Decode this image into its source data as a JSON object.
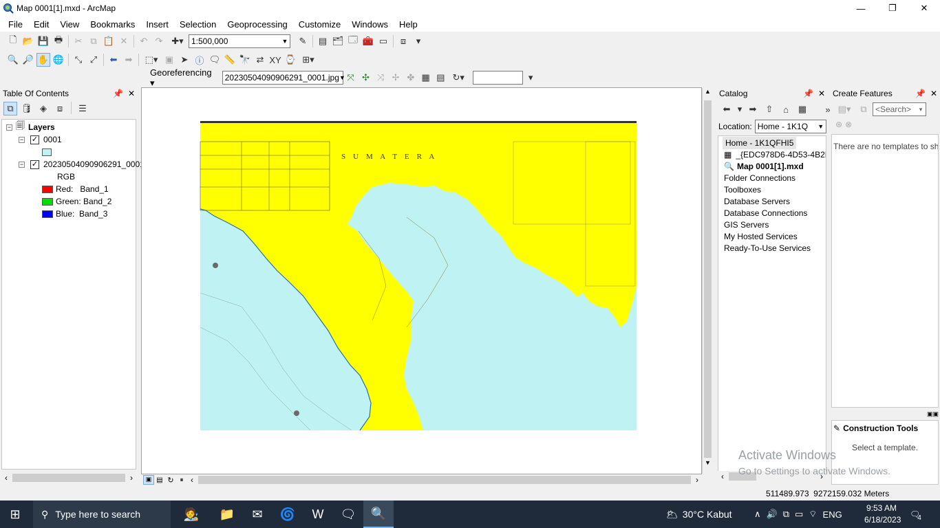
{
  "window": {
    "title": "Map 0001[1].mxd - ArcMap",
    "minimize": "—",
    "maximize": "❐",
    "close": "✕"
  },
  "menu": [
    "File",
    "Edit",
    "View",
    "Bookmarks",
    "Insert",
    "Selection",
    "Geoprocessing",
    "Customize",
    "Windows",
    "Help"
  ],
  "toolbar": {
    "scale": "1:500,000"
  },
  "georef": {
    "label": "Georeferencing",
    "layer": "20230504090906291_0001.jpg"
  },
  "toc": {
    "title": "Table Of Contents",
    "root": "Layers",
    "layers": [
      {
        "name": "0001"
      },
      {
        "name": "20230504090906291_0001.",
        "sub": "RGB",
        "bands": [
          {
            "label": "Red:   Band_1",
            "color": "#ff0000"
          },
          {
            "label": "Green: Band_2",
            "color": "#00e000"
          },
          {
            "label": "Blue:  Band_3",
            "color": "#0000ff"
          }
        ]
      }
    ],
    "swatch_color": "#bff3f3"
  },
  "map": {
    "land_color": "#ffff00",
    "sea_color": "#bff3f3",
    "label_sumatera": "S    U    M    A    T    E    R    A"
  },
  "catalog": {
    "title": "Catalog",
    "location_label": "Location:",
    "location_value": "Home - 1K1Q",
    "items": [
      "Home - 1K1QFHI5",
      "_{EDC978D6-4D53-4B2F",
      "Map 0001[1].mxd",
      "Folder Connections",
      "Toolboxes",
      "Database Servers",
      "Database Connections",
      "GIS Servers",
      "My Hosted Services",
      "Ready-To-Use Services"
    ]
  },
  "create_features": {
    "title": "Create Features",
    "search_placeholder": "<Search>",
    "no_templates": "There are no templates to sh...",
    "construction_tools": "Construction Tools",
    "select_template": "Select a template."
  },
  "status": {
    "coords": "511489.973  9272159.032 Meters"
  },
  "watermark": {
    "line1": "Activate Windows",
    "line2": "Go to Settings to activate Windows."
  },
  "taskbar": {
    "search": "Type here to search",
    "weather": "30°C  Kabut",
    "lang": "ENG",
    "time": "9:53 AM",
    "date": "6/18/2023",
    "notif": "4"
  }
}
